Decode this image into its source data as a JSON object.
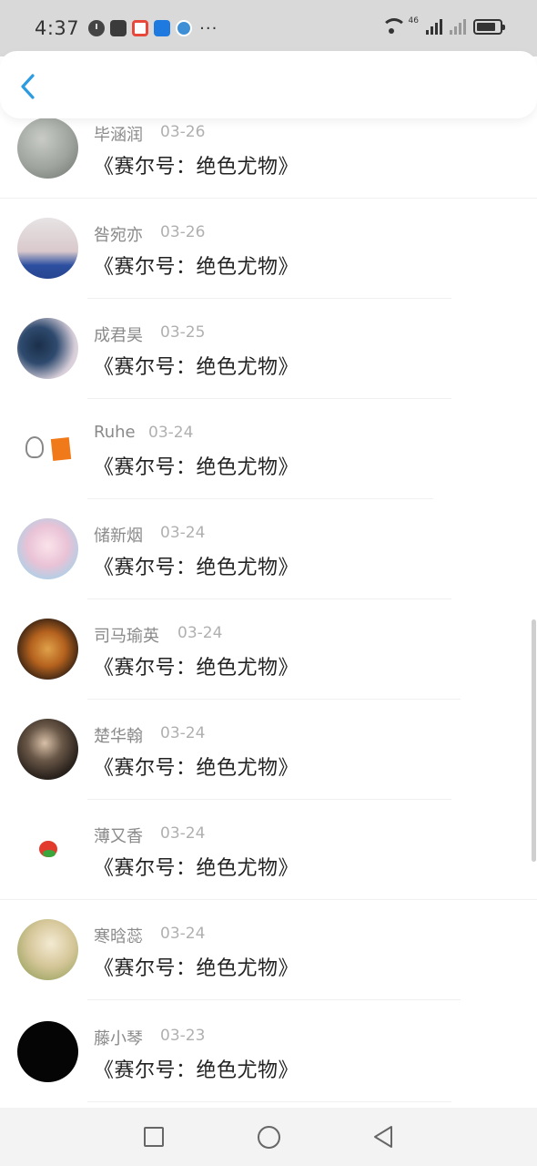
{
  "status_bar": {
    "time": "4:37",
    "more": "···",
    "network_label": "46",
    "battery_percent": 85
  },
  "colors": {
    "accent": "#2c9be0",
    "name_text": "#8a8a8a",
    "date_text": "#b0b0b0",
    "title_text": "#222222"
  },
  "icons": {
    "back": "chevron-left-icon",
    "nav_recents": "square-icon",
    "nav_home": "circle-icon",
    "nav_back": "triangle-left-icon"
  },
  "items": [
    {
      "name": "毕涵润",
      "date": "03-26",
      "title": "《赛尔号：绝色尤物》"
    },
    {
      "name": "咎宛亦",
      "date": "03-26",
      "title": "《赛尔号：绝色尤物》"
    },
    {
      "name": "成君昊",
      "date": "03-25",
      "title": "《赛尔号：绝色尤物》"
    },
    {
      "name": "Ruhe",
      "date": "03-24",
      "title": "《赛尔号：绝色尤物》"
    },
    {
      "name": "储新烟",
      "date": "03-24",
      "title": "《赛尔号：绝色尤物》"
    },
    {
      "name": "司马瑜英",
      "date": "03-24",
      "title": "《赛尔号：绝色尤物》"
    },
    {
      "name": "楚华翰",
      "date": "03-24",
      "title": "《赛尔号：绝色尤物》"
    },
    {
      "name": "薄又香",
      "date": "03-24",
      "title": "《赛尔号：绝色尤物》"
    },
    {
      "name": "寒晗蕊",
      "date": "03-24",
      "title": "《赛尔号：绝色尤物》"
    },
    {
      "name": "藤小琴",
      "date": "03-23",
      "title": "《赛尔号：绝色尤物》"
    }
  ]
}
